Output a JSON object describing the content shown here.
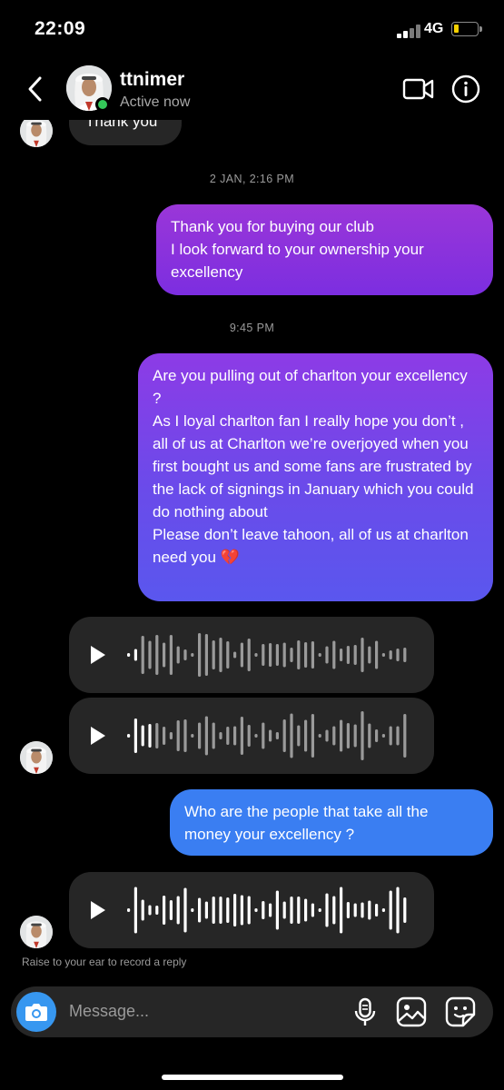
{
  "status_bar": {
    "time": "22:09",
    "network": "4G"
  },
  "header": {
    "username": "ttnimer",
    "status": "Active now"
  },
  "thread": {
    "partial_message": "Thank you",
    "timestamp_1": "2 JAN, 2:16 PM",
    "message_1": "Thank you for buying our club\nI look forward to your ownership your excellency",
    "timestamp_2": "9:45 PM",
    "message_2": "Are you pulling out of charlton your excellency ?\nAs I loyal charlton fan I really hope you don’t , all of us at Charlton we’re overjoyed when you first bought us and some fans are frustrated by the lack of signings in January which you could do nothing about\nPlease don’t leave tahoon, all of us at charlton need you 💔",
    "message_3": "Who are the people that take all the money your excellency ?"
  },
  "footer": {
    "hint": "Raise to your ear to record a reply",
    "placeholder": "Message..."
  },
  "colors": {
    "background": "#000000",
    "incoming_bubble": "#262626",
    "outgoing_blue": "#3a7ef2",
    "camera_button": "#3797f0",
    "online_dot": "#34c759"
  },
  "icons": [
    "back-chevron-icon",
    "video-call-icon",
    "info-icon",
    "play-icon",
    "camera-icon",
    "microphone-icon",
    "gallery-icon",
    "sticker-icon"
  ]
}
